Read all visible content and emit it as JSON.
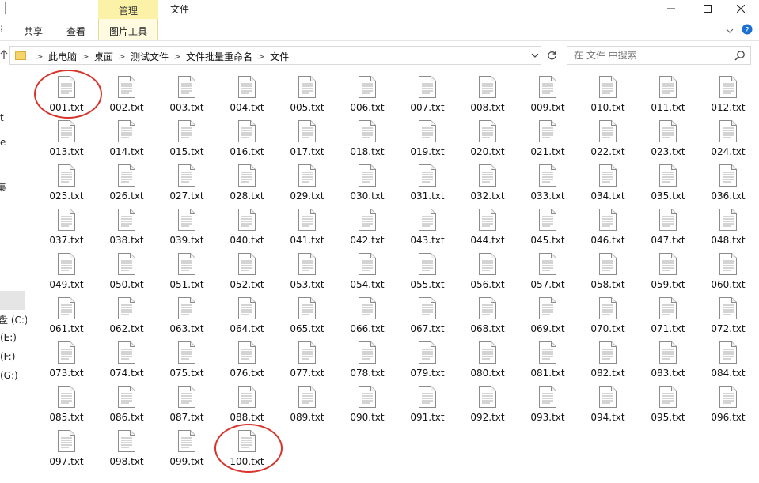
{
  "window": {
    "title": "文件",
    "manage_tab": "管理"
  },
  "ribbon": {
    "tabs": [
      "共享",
      "查看",
      "图片工具"
    ]
  },
  "address": {
    "breadcrumbs": [
      "此电脑",
      "桌面",
      "测试文件",
      "文件批量重命名",
      "文件"
    ]
  },
  "search": {
    "placeholder": "在 文件 中搜索"
  },
  "navpane": {
    "items": [
      "t",
      "e",
      "集",
      "盘 (C:)",
      "(E:)",
      "(F:)",
      "(G:)"
    ]
  },
  "files": [
    "001.txt",
    "002.txt",
    "003.txt",
    "004.txt",
    "005.txt",
    "006.txt",
    "007.txt",
    "008.txt",
    "009.txt",
    "010.txt",
    "011.txt",
    "012.txt",
    "013.txt",
    "014.txt",
    "015.txt",
    "016.txt",
    "017.txt",
    "018.txt",
    "019.txt",
    "020.txt",
    "021.txt",
    "022.txt",
    "023.txt",
    "024.txt",
    "025.txt",
    "026.txt",
    "027.txt",
    "028.txt",
    "029.txt",
    "030.txt",
    "031.txt",
    "032.txt",
    "033.txt",
    "034.txt",
    "035.txt",
    "036.txt",
    "037.txt",
    "038.txt",
    "039.txt",
    "040.txt",
    "041.txt",
    "042.txt",
    "043.txt",
    "044.txt",
    "045.txt",
    "046.txt",
    "047.txt",
    "048.txt",
    "049.txt",
    "050.txt",
    "051.txt",
    "052.txt",
    "053.txt",
    "054.txt",
    "055.txt",
    "056.txt",
    "057.txt",
    "058.txt",
    "059.txt",
    "060.txt",
    "061.txt",
    "062.txt",
    "063.txt",
    "064.txt",
    "065.txt",
    "066.txt",
    "067.txt",
    "068.txt",
    "069.txt",
    "070.txt",
    "071.txt",
    "072.txt",
    "073.txt",
    "074.txt",
    "075.txt",
    "076.txt",
    "077.txt",
    "078.txt",
    "079.txt",
    "080.txt",
    "081.txt",
    "082.txt",
    "083.txt",
    "084.txt",
    "085.txt",
    "086.txt",
    "087.txt",
    "088.txt",
    "089.txt",
    "090.txt",
    "091.txt",
    "092.txt",
    "093.txt",
    "094.txt",
    "095.txt",
    "096.txt",
    "097.txt",
    "098.txt",
    "099.txt",
    "100.txt"
  ],
  "annotations": {
    "circled_files": [
      "001.txt",
      "100.txt"
    ],
    "circle_color": "#d8342c"
  },
  "icons": {
    "file": "text-file-icon",
    "folder": "folder-icon",
    "search": "search-icon",
    "refresh": "refresh-icon"
  },
  "colors": {
    "manage_tab_bg": "#fbf2a7",
    "picture_tools_bg": "#fffbe0"
  }
}
